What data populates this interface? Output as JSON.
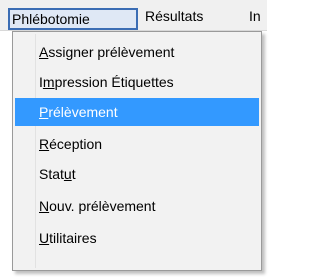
{
  "menubar": {
    "tabs": [
      {
        "label": "Phlébotomie",
        "active": true
      },
      {
        "label": "Résultats",
        "active": false
      },
      {
        "label": "In",
        "active": false
      }
    ]
  },
  "dropdown": {
    "items": [
      {
        "label": "Assigner prélèvement",
        "mnemonic": "A",
        "active": false
      },
      {
        "label": "Impression Étiquettes",
        "mnemonic": "m",
        "active": false
      },
      {
        "label": "Prélèvement",
        "mnemonic": "P",
        "active": true
      },
      {
        "label": "Réception",
        "mnemonic": "R",
        "active": false
      },
      {
        "label": "Statut",
        "mnemonic": "u",
        "active": false
      },
      {
        "label": "Nouv. prélèvement",
        "mnemonic": "N",
        "active": false
      },
      {
        "label": "Utilitaires",
        "mnemonic": "U",
        "active": false
      }
    ],
    "highlight_color": "#3399ff"
  }
}
